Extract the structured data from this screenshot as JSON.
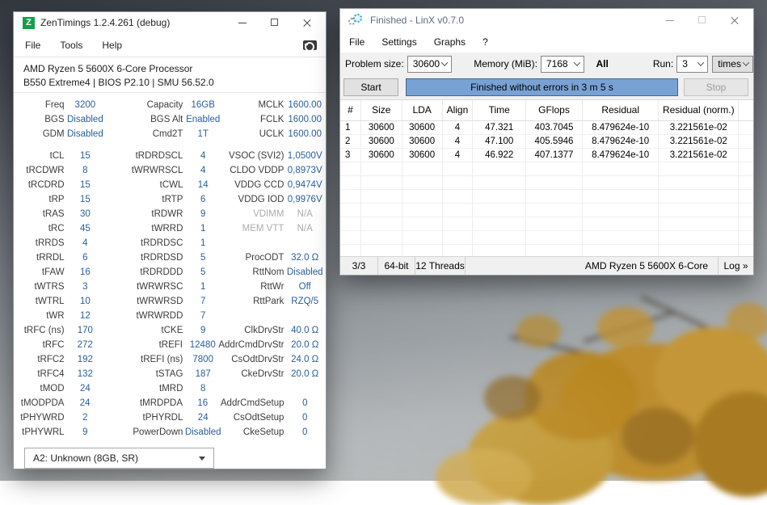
{
  "zentimings": {
    "title": "ZenTimings 1.2.4.261 (debug)",
    "logo_letter": "Z",
    "menu": [
      "File",
      "Tools",
      "Help"
    ],
    "cpu_line1": "AMD Ryzen 5 5600X 6-Core Processor",
    "cpu_line2": "B550 Extreme4 | BIOS P2.10 | SMU 56.52.0",
    "ram_select": "A2: Unknown (8GB, SR)",
    "rows_top": [
      [
        {
          "l": "Freq",
          "v": "3200"
        },
        {
          "l": "Capacity",
          "v": "16GB"
        },
        {
          "l": "MCLK",
          "v": "1600.00"
        }
      ],
      [
        {
          "l": "BGS",
          "v": "Disabled"
        },
        {
          "l": "BGS Alt",
          "v": "Enabled"
        },
        {
          "l": "FCLK",
          "v": "1600.00"
        }
      ],
      [
        {
          "l": "GDM",
          "v": "Disabled"
        },
        {
          "l": "Cmd2T",
          "v": "1T"
        },
        {
          "l": "UCLK",
          "v": "1600.00"
        }
      ]
    ],
    "rows_main": [
      [
        {
          "l": "tCL",
          "v": "15"
        },
        {
          "l": "tRDRDSCL",
          "v": "4"
        },
        {
          "l": "VSOC (SVI2)",
          "v": "1,0500V"
        }
      ],
      [
        {
          "l": "tRCDWR",
          "v": "8"
        },
        {
          "l": "tWRWRSCL",
          "v": "4"
        },
        {
          "l": "CLDO VDDP",
          "v": "0,8973V"
        }
      ],
      [
        {
          "l": "tRCDRD",
          "v": "15"
        },
        {
          "l": "tCWL",
          "v": "14"
        },
        {
          "l": "VDDG CCD",
          "v": "0,9474V"
        }
      ],
      [
        {
          "l": "tRP",
          "v": "15"
        },
        {
          "l": "tRTP",
          "v": "6"
        },
        {
          "l": "VDDG IOD",
          "v": "0,9976V"
        }
      ],
      [
        {
          "l": "tRAS",
          "v": "30"
        },
        {
          "l": "tRDWR",
          "v": "9"
        },
        {
          "l": "VDIMM",
          "v": "N/A",
          "m": true
        }
      ],
      [
        {
          "l": "tRC",
          "v": "45"
        },
        {
          "l": "tWRRD",
          "v": "1"
        },
        {
          "l": "MEM VTT",
          "v": "N/A",
          "m": true
        }
      ],
      [
        {
          "l": "tRRDS",
          "v": "4"
        },
        {
          "l": "tRDRDSC",
          "v": "1"
        },
        null
      ],
      [
        {
          "l": "tRRDL",
          "v": "6"
        },
        {
          "l": "tRDRDSD",
          "v": "5"
        },
        {
          "l": "ProcODT",
          "v": "32.0 Ω"
        }
      ],
      [
        {
          "l": "tFAW",
          "v": "16"
        },
        {
          "l": "tRDRDDD",
          "v": "5"
        },
        {
          "l": "RttNom",
          "v": "Disabled"
        }
      ],
      [
        {
          "l": "tWTRS",
          "v": "3"
        },
        {
          "l": "tWRWRSC",
          "v": "1"
        },
        {
          "l": "RttWr",
          "v": "Off"
        }
      ],
      [
        {
          "l": "tWTRL",
          "v": "10"
        },
        {
          "l": "tWRWRSD",
          "v": "7"
        },
        {
          "l": "RttPark",
          "v": "RZQ/5"
        }
      ],
      [
        {
          "l": "tWR",
          "v": "12"
        },
        {
          "l": "tWRWRDD",
          "v": "7"
        },
        null
      ],
      [
        {
          "l": "tRFC (ns)",
          "v": "170"
        },
        {
          "l": "tCKE",
          "v": "9"
        },
        {
          "l": "ClkDrvStr",
          "v": "40.0 Ω"
        }
      ],
      [
        {
          "l": "tRFC",
          "v": "272"
        },
        {
          "l": "tREFI",
          "v": "12480"
        },
        {
          "l": "AddrCmdDrvStr",
          "v": "20.0 Ω"
        }
      ],
      [
        {
          "l": "tRFC2",
          "v": "192"
        },
        {
          "l": "tREFI (ns)",
          "v": "7800"
        },
        {
          "l": "CsOdtDrvStr",
          "v": "24.0 Ω"
        }
      ],
      [
        {
          "l": "tRFC4",
          "v": "132"
        },
        {
          "l": "tSTAG",
          "v": "187"
        },
        {
          "l": "CkeDrvStr",
          "v": "20.0 Ω"
        }
      ],
      [
        {
          "l": "tMOD",
          "v": "24"
        },
        {
          "l": "tMRD",
          "v": "8"
        },
        null
      ],
      [
        {
          "l": "tMODPDA",
          "v": "24"
        },
        {
          "l": "tMRDPDA",
          "v": "16"
        },
        {
          "l": "AddrCmdSetup",
          "v": "0"
        }
      ],
      [
        {
          "l": "tPHYWRD",
          "v": "2"
        },
        {
          "l": "tPHYRDL",
          "v": "24"
        },
        {
          "l": "CsOdtSetup",
          "v": "0"
        }
      ],
      [
        {
          "l": "tPHYWRL",
          "v": "9"
        },
        {
          "l": "PowerDown",
          "v": "Disabled"
        },
        {
          "l": "CkeSetup",
          "v": "0"
        }
      ]
    ]
  },
  "linx": {
    "title": "Finished - LinX v0.7.0",
    "menu": [
      "File",
      "Settings",
      "Graphs",
      "?"
    ],
    "controls": {
      "problem_size_label": "Problem size:",
      "problem_size": "30600",
      "memory_label": "Memory (MiB):",
      "memory": "7168",
      "all_label": "All",
      "run_label": "Run:",
      "run_count": "3",
      "run_unit": "times"
    },
    "start_label": "Start",
    "progress_text": "Finished without errors in 3 m 5 s",
    "stop_label": "Stop",
    "table": {
      "headers": [
        "#",
        "Size",
        "LDA",
        "Align",
        "Time",
        "GFlops",
        "Residual",
        "Residual (norm.)"
      ],
      "rows": [
        [
          "1",
          "30600",
          "30600",
          "4",
          "47.321",
          "403.7045",
          "8.479624e-10",
          "3.221561e-02"
        ],
        [
          "2",
          "30600",
          "30600",
          "4",
          "47.100",
          "405.5946",
          "8.479624e-10",
          "3.221561e-02"
        ],
        [
          "3",
          "30600",
          "30600",
          "4",
          "46.922",
          "407.1377",
          "8.479624e-10",
          "3.221561e-02"
        ]
      ],
      "empty_rows": 7
    },
    "status": {
      "progress": "3/3",
      "arch": "64-bit",
      "threads": "12 Threads",
      "cpu": "AMD Ryzen 5 5600X 6-Core",
      "log": "Log »"
    }
  },
  "colors": {
    "zen_value_blue": "#295e9d",
    "zen_logo_green": "#14a04a",
    "muted_gray": "#ababab",
    "progress_fill": "#78a2d4",
    "progress_border": "#3d659a",
    "linx_title_text": "#5c6b7a",
    "tree_gold": "#bd8d2e"
  }
}
